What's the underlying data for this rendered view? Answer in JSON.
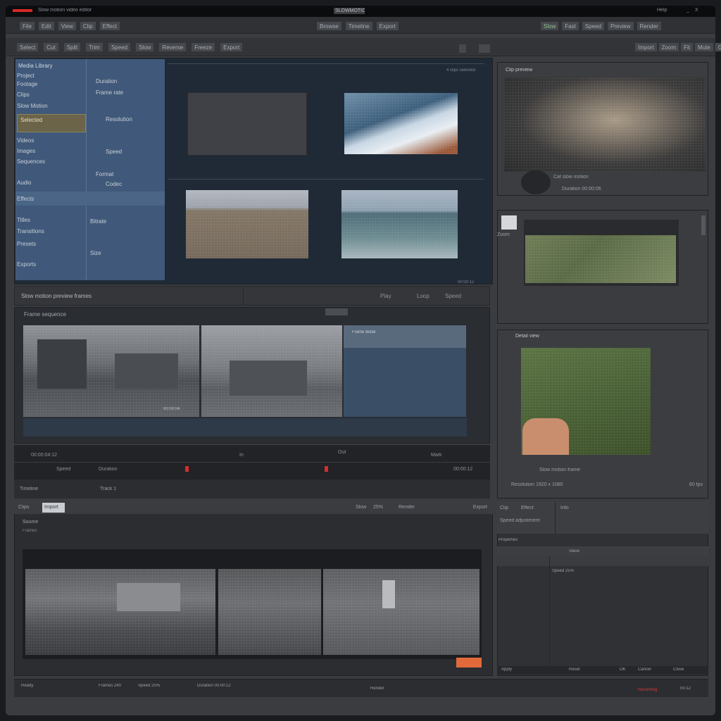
{
  "window": {
    "title": "SLOWMOTION",
    "app_label": "Slow motion video editor",
    "controls": [
      "Help",
      "_",
      "X"
    ]
  },
  "menubar": {
    "left": [
      "File",
      "Edit",
      "View",
      "Clip",
      "Effect"
    ],
    "center": [
      "Browse",
      "Timeline",
      "Export"
    ],
    "right": [
      "Slow",
      "Fast",
      "Speed",
      "Preview",
      "Render"
    ]
  },
  "toolbar": {
    "left": [
      "Select",
      "Cut",
      "Split",
      "Trim",
      "Speed",
      "Slow",
      "Reverse",
      "Freeze",
      "Export"
    ],
    "right": [
      "Import",
      "Zoom",
      "Fit",
      "Mute",
      "Grid"
    ]
  },
  "left_panel": {
    "header": "Media Library",
    "items": [
      "Project",
      "Footage",
      "Clips",
      "Slow Motion",
      "Selected",
      "Videos",
      "Images",
      "Sequences",
      "Audio",
      "Effects",
      "Titles",
      "Transitions",
      "Presets",
      "Exports"
    ],
    "selected": "Slow Motion",
    "detail_items": [
      "Duration",
      "Frame rate",
      "Resolution",
      "Speed",
      "Format",
      "Codec",
      "Bitrate",
      "Size"
    ]
  },
  "preview_area": {
    "label": "4 clips selected",
    "footer": "00:00:12"
  },
  "mid_bar": {
    "title": "Slow motion preview frames",
    "right": [
      "Play",
      "Loop",
      "Speed"
    ]
  },
  "filmstrip": {
    "header": "Frame sequence",
    "frame_label": "00:00:04",
    "panel_label": "Frame detail"
  },
  "transport": {
    "time": "00:00:04:12",
    "labels": [
      "In",
      "Out",
      "Mark",
      "Speed",
      "Duration"
    ],
    "end": "00:00:12"
  },
  "status_mid": {
    "left": "Timeline",
    "value": "Track 1"
  },
  "bottom_panel": {
    "tabs": [
      "Clips",
      "Import"
    ],
    "active_tab": "Import",
    "header": "Source",
    "sub": "Frames",
    "right": [
      "Slow",
      "25%",
      "Render",
      "Export"
    ]
  },
  "right_col": {
    "top_header": "Clip preview",
    "top_caption": "Cat slow motion",
    "top_sub": "Duration 00:00:06",
    "mid_label": "Zoom",
    "lower_header": "Detail view",
    "lower_caption": "Slow motion frame",
    "lower_footer_left": "Resolution 1920 x 1080",
    "lower_footer_right": "60 fps",
    "properties_tabs": [
      "Clip",
      "Effect",
      "Info"
    ],
    "properties_sub": "Speed adjustment",
    "list_header": "Properties",
    "list_col": "Value",
    "list_item": "Speed 25%",
    "footer_items": [
      "Apply",
      "Reset",
      "OK",
      "Cancel",
      "Close"
    ]
  },
  "statusbar": {
    "left": "Ready",
    "items": [
      "Frames 240",
      "Speed 25%",
      "Duration 00:00:12",
      "Render"
    ],
    "right_red": "Recording",
    "right": "00:12"
  }
}
